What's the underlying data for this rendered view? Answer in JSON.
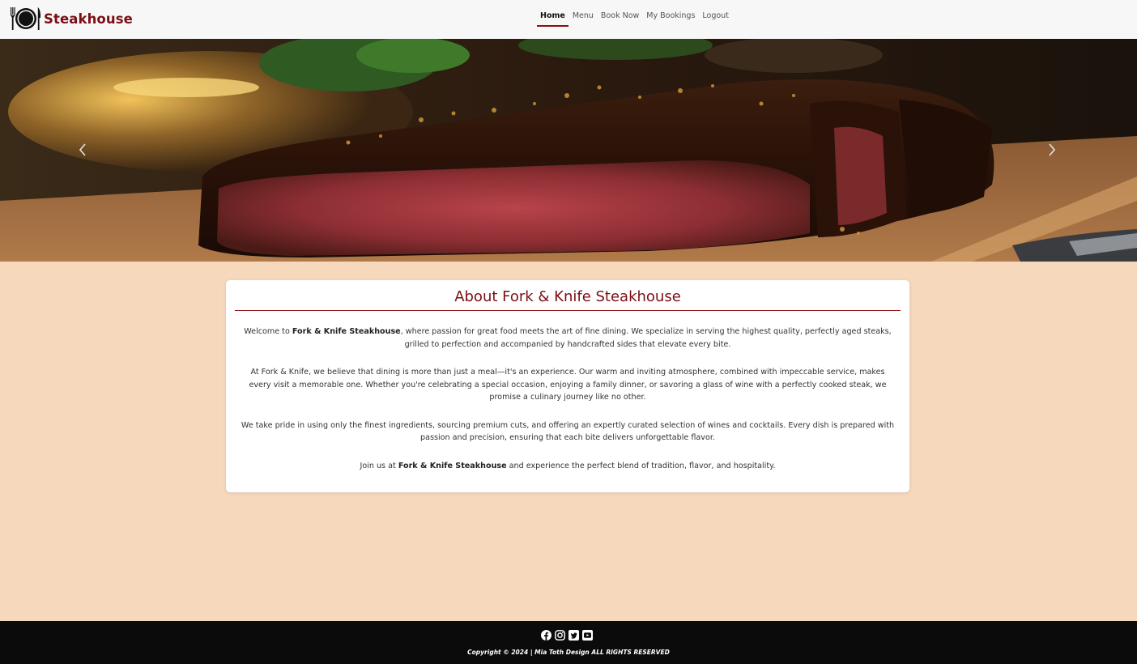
{
  "nav": {
    "brand": "Steakhouse",
    "links": [
      "Home",
      "Menu",
      "Book Now",
      "My Bookings",
      "Logout"
    ],
    "active": "Home"
  },
  "hero": {
    "prev_icon": "chevron-left-icon",
    "next_icon": "chevron-right-icon"
  },
  "about": {
    "title": "About Fork & Knife Steakhouse",
    "p1_pre": "Welcome to ",
    "p1_bold": "Fork & Knife Steakhouse",
    "p1_post": ", where passion for great food meets the art of fine dining. We specialize in serving the highest quality, perfectly aged steaks, grilled to perfection and accompanied by handcrafted sides that elevate every bite.",
    "p2": "At Fork & Knife, we believe that dining is more than just a meal—it's an experience. Our warm and inviting atmosphere, combined with impeccable service, makes every visit a memorable one. Whether you're celebrating a special occasion, enjoying a family dinner, or savoring a glass of wine with a perfectly cooked steak, we promise a culinary journey like no other.",
    "p3": "We take pride in using only the finest ingredients, sourcing premium cuts, and offering an expertly curated selection of wines and cocktails. Every dish is prepared with passion and precision, ensuring that each bite delivers unforgettable flavor.",
    "p4_pre": "Join us at ",
    "p4_bold": "Fork & Knife Steakhouse",
    "p4_post": " and experience the perfect blend of tradition, flavor, and hospitality."
  },
  "footer": {
    "social_icons": [
      "facebook-icon",
      "instagram-icon",
      "twitter-icon",
      "youtube-icon"
    ],
    "copyright": "Copyright © 2024 | Mia Toth Design ALL RIGHTS RESERVED"
  },
  "colors": {
    "brand": "#7a0f14",
    "page_background": "#f6d8bd",
    "footer_background": "#0b0b0b"
  }
}
